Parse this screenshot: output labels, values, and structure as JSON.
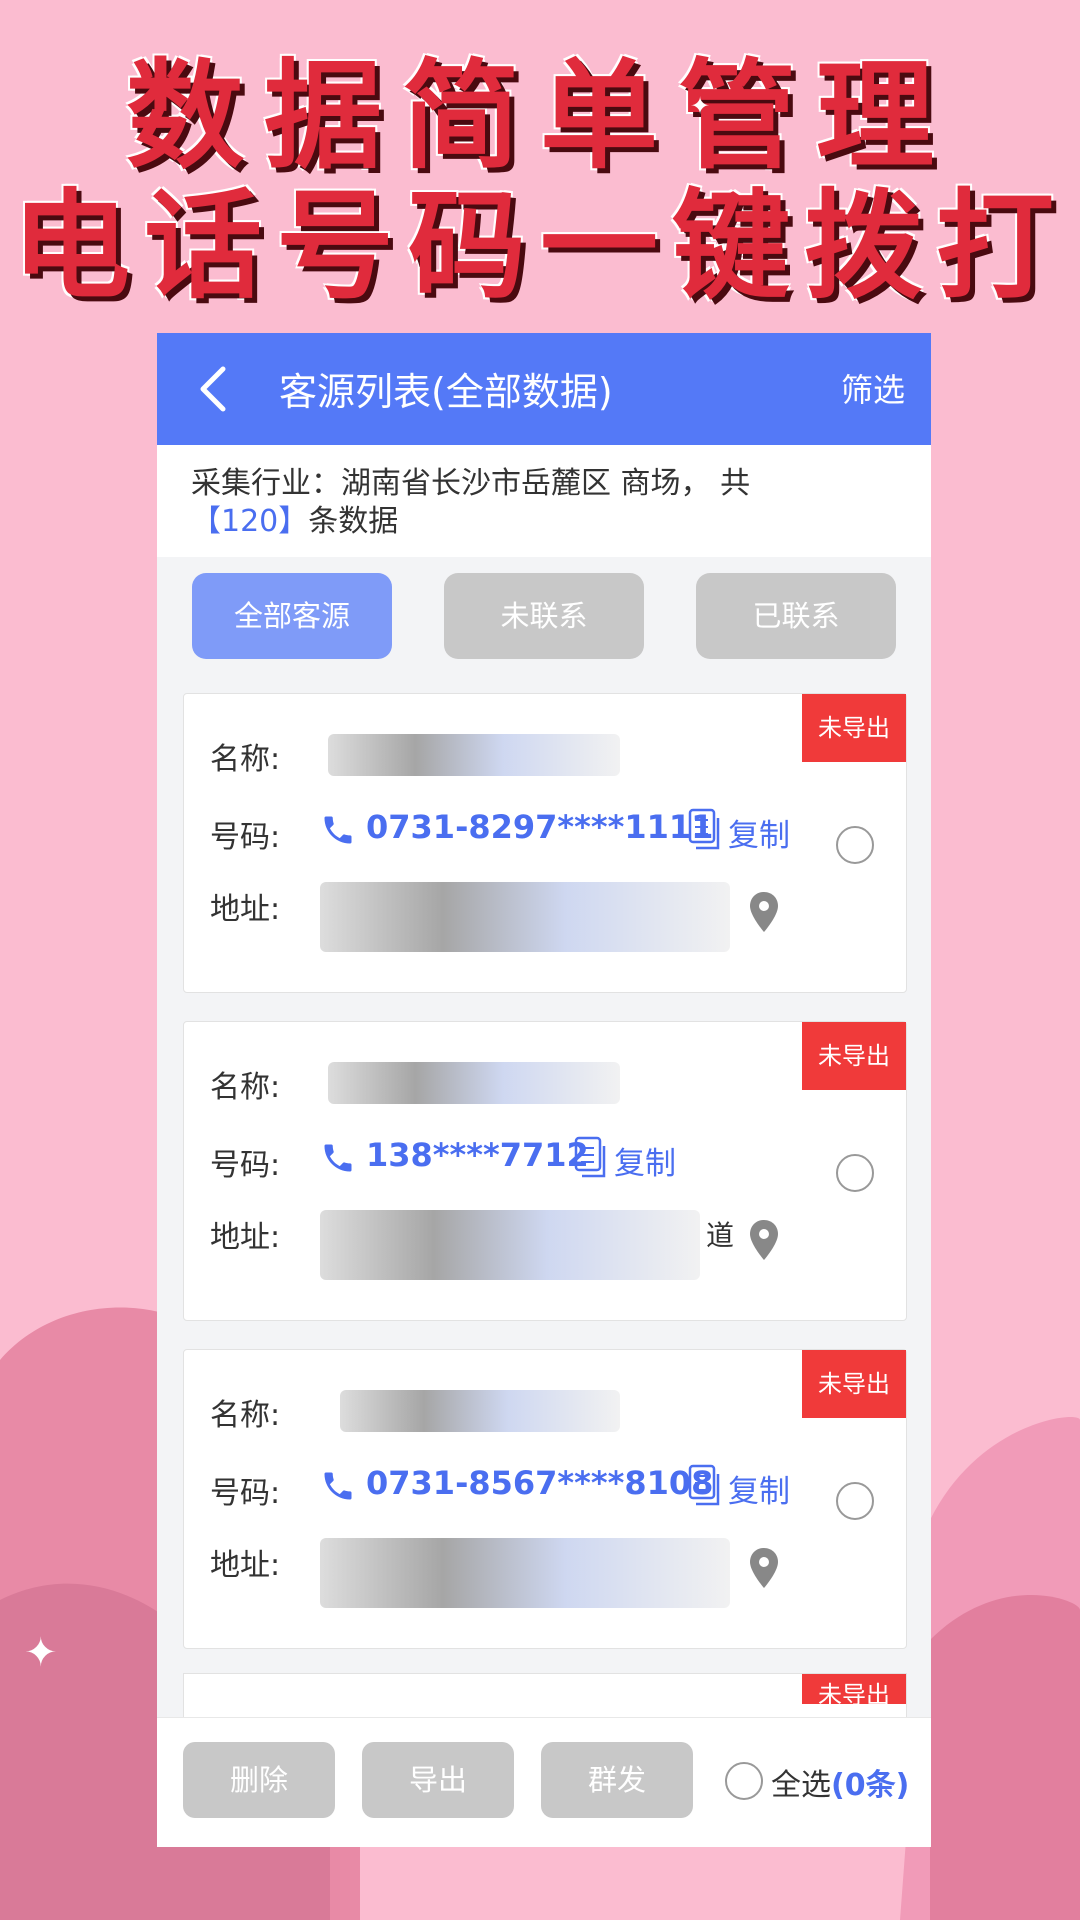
{
  "promo": {
    "line1": "数据简单管理",
    "line2": "电话号码一键拨打"
  },
  "header": {
    "title": "客源列表(全部数据)",
    "filter_label": "筛选",
    "back_icon": "chevron-left-icon"
  },
  "info": {
    "prefix": "采集行业：湖南省长沙市岳麓区 商场， 共",
    "count": "【120】",
    "suffix": "条数据"
  },
  "tabs": [
    {
      "label": "全部客源",
      "active": true
    },
    {
      "label": "未联系",
      "active": false
    },
    {
      "label": "已联系",
      "active": false
    }
  ],
  "labels": {
    "name": "名称:",
    "phone": "号码:",
    "address": "地址:",
    "copy": "复制"
  },
  "cards": [
    {
      "badge": "未导出",
      "name_partial": "",
      "phone": "0731-8297****1111",
      "address_partial": ""
    },
    {
      "badge": "未导出",
      "name_partial": "",
      "phone": "138****7712",
      "address_partial": "道"
    },
    {
      "badge": "未导出",
      "name_partial": "",
      "phone": "0731-8567****8108",
      "address_partial": ""
    }
  ],
  "partial_card_badge": "未导出",
  "bottom": {
    "delete_label": "删除",
    "export_label": "导出",
    "group_label": "群发",
    "select_all_label": "全选",
    "selected_count": "(0条)"
  },
  "colors": {
    "accent": "#5479f7",
    "link": "#4a6ef0",
    "badge": "#f03a3a",
    "page_bg": "#fbbcd0"
  }
}
